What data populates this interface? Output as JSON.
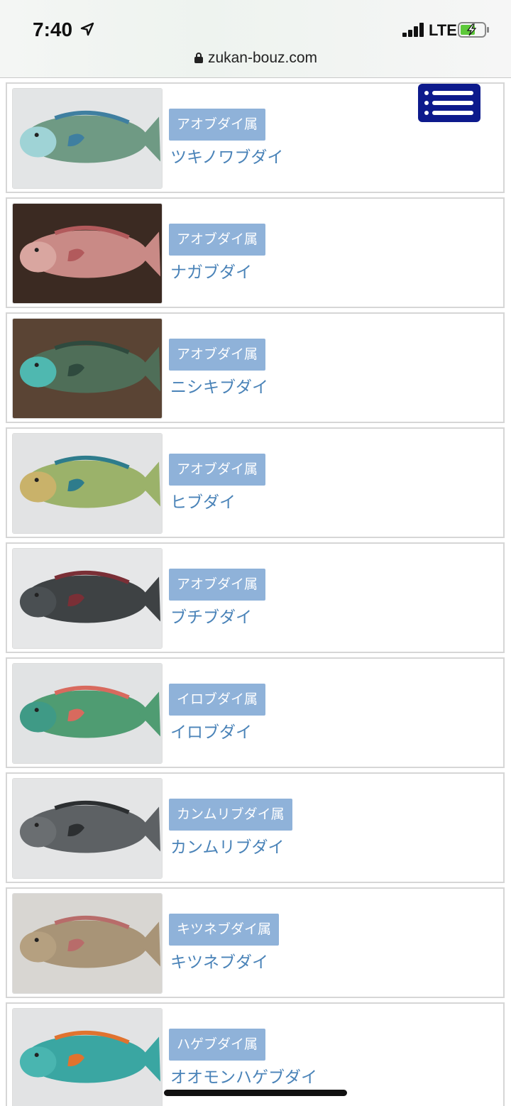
{
  "status": {
    "time": "7:40",
    "network": "LTE"
  },
  "browser": {
    "url": "zukan-bouz.com"
  },
  "icons": {
    "location": "location-arrow-icon",
    "lock": "lock-icon",
    "menu": "hamburger-menu-icon",
    "battery": "battery-charging-icon"
  },
  "colors": {
    "genus_bg": "#8fb2d9",
    "species_text": "#4a83b8",
    "menu_bg": "#0d1a8c"
  },
  "items": [
    {
      "genus": "アオブダイ属",
      "name": "ツキノワブダイ",
      "bg": "#e3e5e6",
      "body": "#6f9a84",
      "accent": "#3f7fa0",
      "head": "#9fd3d6"
    },
    {
      "genus": "アオブダイ属",
      "name": "ナガブダイ",
      "bg": "#3b2a22",
      "body": "#c98a86",
      "accent": "#b25a5c",
      "head": "#d9a6a0"
    },
    {
      "genus": "アオブダイ属",
      "name": "ニシキブダイ",
      "bg": "#5a4434",
      "body": "#4f6e58",
      "accent": "#2f4a3e",
      "head": "#4fb8b0"
    },
    {
      "genus": "アオブダイ属",
      "name": "ヒブダイ",
      "bg": "#e2e3e4",
      "body": "#9bb26a",
      "accent": "#2e7c8c",
      "head": "#c9b26a"
    },
    {
      "genus": "アオブダイ属",
      "name": "ブチブダイ",
      "bg": "#e6e7e8",
      "body": "#3e4244",
      "accent": "#7a2f36",
      "head": "#4a4f52"
    },
    {
      "genus": "イロブダイ属",
      "name": "イロブダイ",
      "bg": "#e1e3e4",
      "body": "#4f9c72",
      "accent": "#d86a5e",
      "head": "#3f9a86"
    },
    {
      "genus": "カンムリブダイ属",
      "name": "カンムリブダイ",
      "bg": "#e4e5e6",
      "body": "#5d6164",
      "accent": "#2c2f31",
      "head": "#6a6e71"
    },
    {
      "genus": "キツネブダイ属",
      "name": "キツネブダイ",
      "bg": "#d8d6d2",
      "body": "#a89477",
      "accent": "#b86c6a",
      "head": "#b5a080"
    },
    {
      "genus": "ハゲブダイ属",
      "name": "オオモンハゲブダイ",
      "bg": "#e2e3e4",
      "body": "#3aa6a2",
      "accent": "#e0732f",
      "head": "#49b5b0"
    }
  ]
}
